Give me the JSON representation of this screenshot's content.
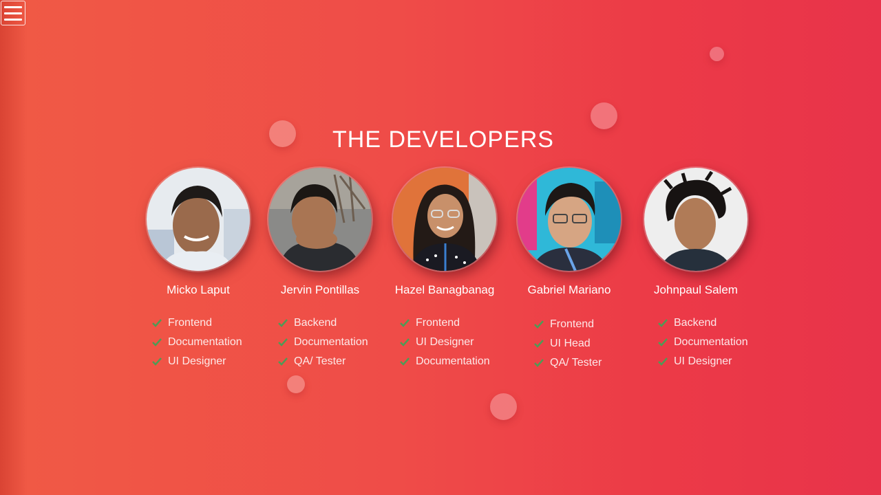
{
  "page": {
    "title": "THE DEVELOPERS",
    "menu_icon": "hamburger-menu-icon"
  },
  "colors": {
    "background_start": "#f05a45",
    "background_end": "#e8334a",
    "check": "#4f9a55",
    "text": "#ffffff"
  },
  "developers": [
    {
      "name": "Micko Laput",
      "roles": [
        "Frontend",
        "Documentation",
        "UI Designer"
      ]
    },
    {
      "name": "Jervin Pontillas",
      "roles": [
        "Backend",
        "Documentation",
        "QA/ Tester"
      ]
    },
    {
      "name": "Hazel Banagbanag",
      "roles": [
        "Frontend",
        "UI Designer",
        "Documentation"
      ]
    },
    {
      "name": "Gabriel Mariano",
      "roles": [
        "Frontend",
        "UI Head",
        "QA/ Tester"
      ]
    },
    {
      "name": "Johnpaul Salem",
      "roles": [
        "Backend",
        "Documentation",
        "UI Designer"
      ]
    }
  ]
}
